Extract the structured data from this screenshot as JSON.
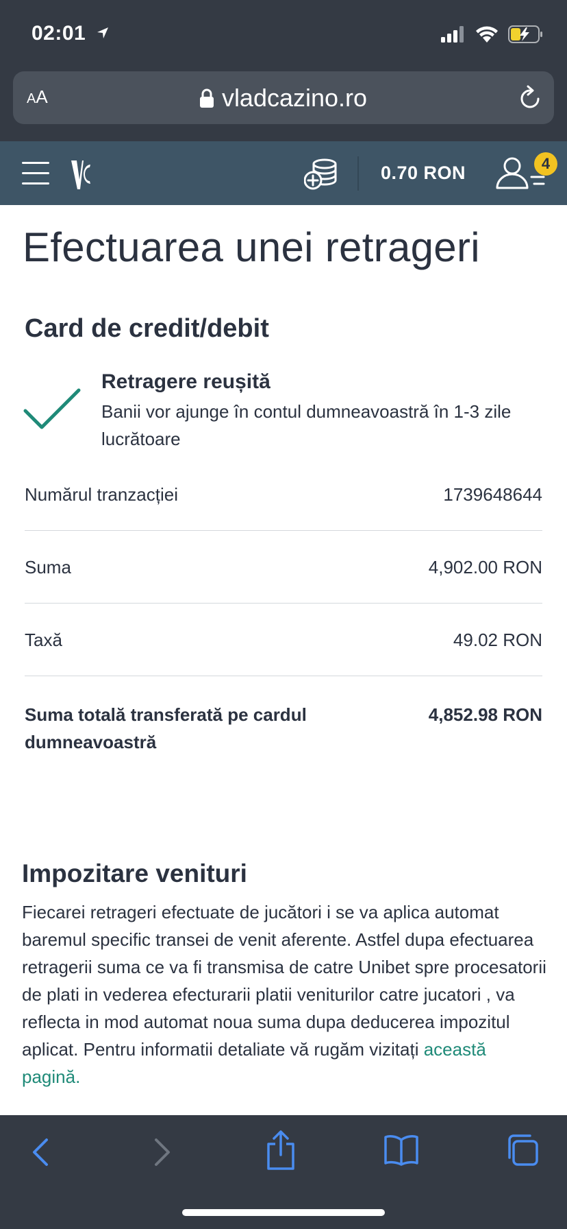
{
  "status_bar": {
    "time": "02:01"
  },
  "browser": {
    "text_size_label_small": "A",
    "text_size_label_large": "A",
    "url": "vladcazino.ro"
  },
  "header": {
    "balance": "0.70 RON",
    "notification_count": "4"
  },
  "page": {
    "title": "Efectuarea unei retrageri",
    "method_title": "Card de credit/debit",
    "success_title": "Retragere reușită",
    "success_description": "Banii vor ajunge în contul dumneavoastră în 1-3 zile lucrătoare",
    "details": [
      {
        "label": "Numărul tranzacției",
        "value": "1739648644"
      },
      {
        "label": "Suma",
        "value": "4,902.00 RON"
      },
      {
        "label": "Taxă",
        "value": "49.02 RON"
      }
    ],
    "total": {
      "label": "Suma totală transferată pe cardul dumneavoastră",
      "value": "4,852.98 RON"
    },
    "tax_section": {
      "title": "Impozitare venituri",
      "body": "Fiecarei retrageri efectuate de jucători i se va aplica automat baremul specific transei de venit aferente. Astfel dupa efectuarea retragerii suma ce va fi transmisa de catre Unibet spre procesatorii de plati in vederea efecturarii platii veniturilor catre jucatori , va reflecta in mod automat noua suma dupa deducerea impozitul aplicat. Pentru informatii detaliate vă rugăm vizitați ",
      "link_text": "această pagină."
    }
  },
  "colors": {
    "chrome_dark": "#343a44",
    "header_bg": "#3e5566",
    "accent_green": "#1f8a78",
    "badge_yellow": "#f2c321",
    "text_dark": "#2b3240"
  }
}
